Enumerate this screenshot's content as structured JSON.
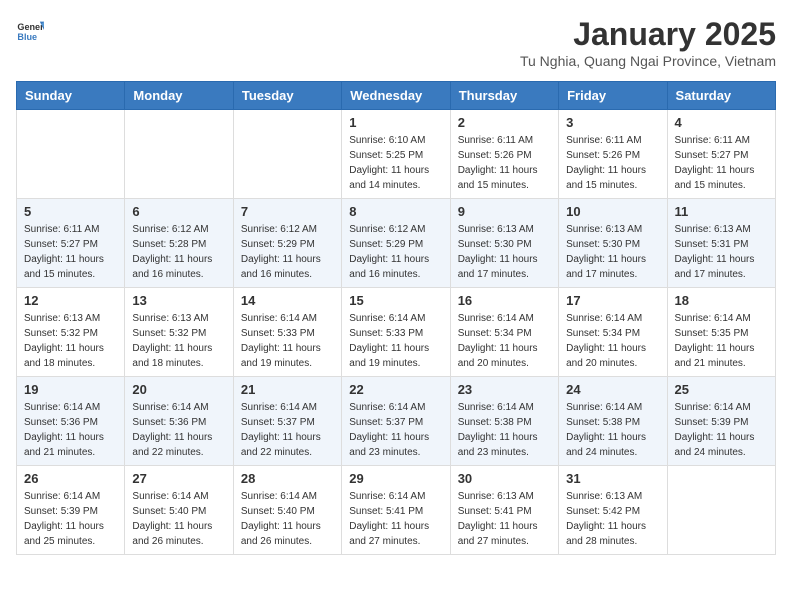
{
  "header": {
    "logo_general": "General",
    "logo_blue": "Blue",
    "month_year": "January 2025",
    "location": "Tu Nghia, Quang Ngai Province, Vietnam"
  },
  "weekdays": [
    "Sunday",
    "Monday",
    "Tuesday",
    "Wednesday",
    "Thursday",
    "Friday",
    "Saturday"
  ],
  "weeks": [
    [
      {
        "day": "",
        "sunrise": "",
        "sunset": "",
        "daylight": ""
      },
      {
        "day": "",
        "sunrise": "",
        "sunset": "",
        "daylight": ""
      },
      {
        "day": "",
        "sunrise": "",
        "sunset": "",
        "daylight": ""
      },
      {
        "day": "1",
        "sunrise": "Sunrise: 6:10 AM",
        "sunset": "Sunset: 5:25 PM",
        "daylight": "Daylight: 11 hours and 14 minutes."
      },
      {
        "day": "2",
        "sunrise": "Sunrise: 6:11 AM",
        "sunset": "Sunset: 5:26 PM",
        "daylight": "Daylight: 11 hours and 15 minutes."
      },
      {
        "day": "3",
        "sunrise": "Sunrise: 6:11 AM",
        "sunset": "Sunset: 5:26 PM",
        "daylight": "Daylight: 11 hours and 15 minutes."
      },
      {
        "day": "4",
        "sunrise": "Sunrise: 6:11 AM",
        "sunset": "Sunset: 5:27 PM",
        "daylight": "Daylight: 11 hours and 15 minutes."
      }
    ],
    [
      {
        "day": "5",
        "sunrise": "Sunrise: 6:11 AM",
        "sunset": "Sunset: 5:27 PM",
        "daylight": "Daylight: 11 hours and 15 minutes."
      },
      {
        "day": "6",
        "sunrise": "Sunrise: 6:12 AM",
        "sunset": "Sunset: 5:28 PM",
        "daylight": "Daylight: 11 hours and 16 minutes."
      },
      {
        "day": "7",
        "sunrise": "Sunrise: 6:12 AM",
        "sunset": "Sunset: 5:29 PM",
        "daylight": "Daylight: 11 hours and 16 minutes."
      },
      {
        "day": "8",
        "sunrise": "Sunrise: 6:12 AM",
        "sunset": "Sunset: 5:29 PM",
        "daylight": "Daylight: 11 hours and 16 minutes."
      },
      {
        "day": "9",
        "sunrise": "Sunrise: 6:13 AM",
        "sunset": "Sunset: 5:30 PM",
        "daylight": "Daylight: 11 hours and 17 minutes."
      },
      {
        "day": "10",
        "sunrise": "Sunrise: 6:13 AM",
        "sunset": "Sunset: 5:30 PM",
        "daylight": "Daylight: 11 hours and 17 minutes."
      },
      {
        "day": "11",
        "sunrise": "Sunrise: 6:13 AM",
        "sunset": "Sunset: 5:31 PM",
        "daylight": "Daylight: 11 hours and 17 minutes."
      }
    ],
    [
      {
        "day": "12",
        "sunrise": "Sunrise: 6:13 AM",
        "sunset": "Sunset: 5:32 PM",
        "daylight": "Daylight: 11 hours and 18 minutes."
      },
      {
        "day": "13",
        "sunrise": "Sunrise: 6:13 AM",
        "sunset": "Sunset: 5:32 PM",
        "daylight": "Daylight: 11 hours and 18 minutes."
      },
      {
        "day": "14",
        "sunrise": "Sunrise: 6:14 AM",
        "sunset": "Sunset: 5:33 PM",
        "daylight": "Daylight: 11 hours and 19 minutes."
      },
      {
        "day": "15",
        "sunrise": "Sunrise: 6:14 AM",
        "sunset": "Sunset: 5:33 PM",
        "daylight": "Daylight: 11 hours and 19 minutes."
      },
      {
        "day": "16",
        "sunrise": "Sunrise: 6:14 AM",
        "sunset": "Sunset: 5:34 PM",
        "daylight": "Daylight: 11 hours and 20 minutes."
      },
      {
        "day": "17",
        "sunrise": "Sunrise: 6:14 AM",
        "sunset": "Sunset: 5:34 PM",
        "daylight": "Daylight: 11 hours and 20 minutes."
      },
      {
        "day": "18",
        "sunrise": "Sunrise: 6:14 AM",
        "sunset": "Sunset: 5:35 PM",
        "daylight": "Daylight: 11 hours and 21 minutes."
      }
    ],
    [
      {
        "day": "19",
        "sunrise": "Sunrise: 6:14 AM",
        "sunset": "Sunset: 5:36 PM",
        "daylight": "Daylight: 11 hours and 21 minutes."
      },
      {
        "day": "20",
        "sunrise": "Sunrise: 6:14 AM",
        "sunset": "Sunset: 5:36 PM",
        "daylight": "Daylight: 11 hours and 22 minutes."
      },
      {
        "day": "21",
        "sunrise": "Sunrise: 6:14 AM",
        "sunset": "Sunset: 5:37 PM",
        "daylight": "Daylight: 11 hours and 22 minutes."
      },
      {
        "day": "22",
        "sunrise": "Sunrise: 6:14 AM",
        "sunset": "Sunset: 5:37 PM",
        "daylight": "Daylight: 11 hours and 23 minutes."
      },
      {
        "day": "23",
        "sunrise": "Sunrise: 6:14 AM",
        "sunset": "Sunset: 5:38 PM",
        "daylight": "Daylight: 11 hours and 23 minutes."
      },
      {
        "day": "24",
        "sunrise": "Sunrise: 6:14 AM",
        "sunset": "Sunset: 5:38 PM",
        "daylight": "Daylight: 11 hours and 24 minutes."
      },
      {
        "day": "25",
        "sunrise": "Sunrise: 6:14 AM",
        "sunset": "Sunset: 5:39 PM",
        "daylight": "Daylight: 11 hours and 24 minutes."
      }
    ],
    [
      {
        "day": "26",
        "sunrise": "Sunrise: 6:14 AM",
        "sunset": "Sunset: 5:39 PM",
        "daylight": "Daylight: 11 hours and 25 minutes."
      },
      {
        "day": "27",
        "sunrise": "Sunrise: 6:14 AM",
        "sunset": "Sunset: 5:40 PM",
        "daylight": "Daylight: 11 hours and 26 minutes."
      },
      {
        "day": "28",
        "sunrise": "Sunrise: 6:14 AM",
        "sunset": "Sunset: 5:40 PM",
        "daylight": "Daylight: 11 hours and 26 minutes."
      },
      {
        "day": "29",
        "sunrise": "Sunrise: 6:14 AM",
        "sunset": "Sunset: 5:41 PM",
        "daylight": "Daylight: 11 hours and 27 minutes."
      },
      {
        "day": "30",
        "sunrise": "Sunrise: 6:13 AM",
        "sunset": "Sunset: 5:41 PM",
        "daylight": "Daylight: 11 hours and 27 minutes."
      },
      {
        "day": "31",
        "sunrise": "Sunrise: 6:13 AM",
        "sunset": "Sunset: 5:42 PM",
        "daylight": "Daylight: 11 hours and 28 minutes."
      },
      {
        "day": "",
        "sunrise": "",
        "sunset": "",
        "daylight": ""
      }
    ]
  ]
}
